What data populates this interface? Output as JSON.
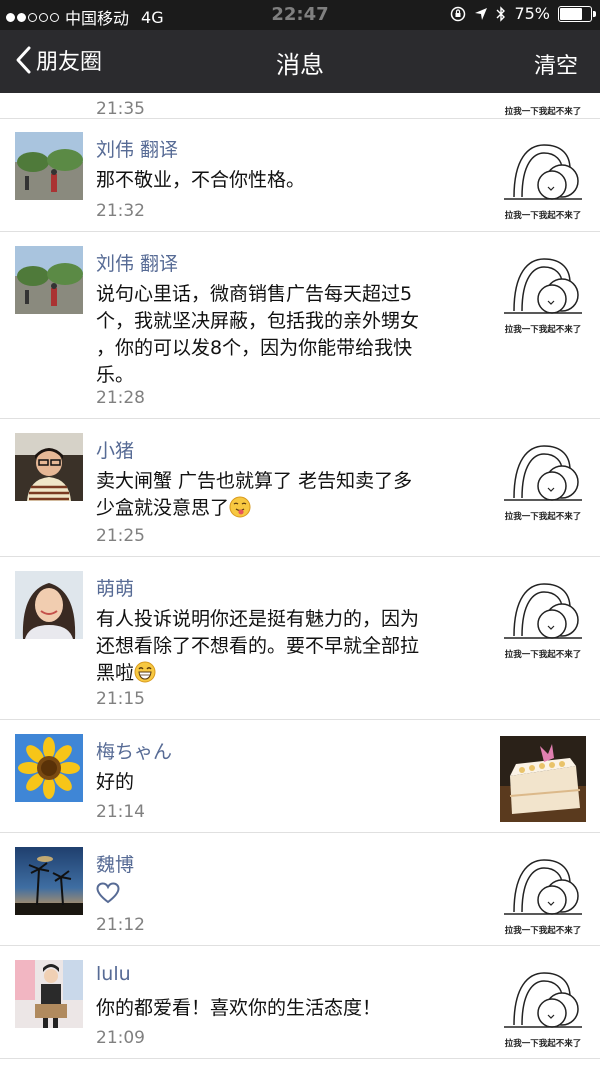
{
  "status": {
    "carrier": "中国移动",
    "network": "4G",
    "time": "22:47",
    "battery": "75%",
    "battery_level": 0.75
  },
  "nav": {
    "back_label": "朋友圈",
    "title": "消息",
    "clear_label": "清空"
  },
  "sticker_caption": "拉我一下我起不来了",
  "partial_row": {
    "time": "21:35"
  },
  "rows": [
    {
      "name": "刘伟 翻译",
      "message": "那不敬业，不合你性格。",
      "time": "21:32",
      "avatar": "park-photo",
      "thumb": "sticker"
    },
    {
      "name": "刘伟 翻译",
      "message_lines": [
        "说句心里话，微商销售广告每天超过5",
        "个，我就坚决屏蔽，包括我的亲外甥女",
        "，你的可以发8个，因为你能带给我快",
        "乐。"
      ],
      "time": "21:28",
      "avatar": "park-photo",
      "thumb": "sticker"
    },
    {
      "name": "小猪",
      "message_lines": [
        "卖大闸蟹 广告也就算了 老告知卖了多",
        "少盒就没意思了"
      ],
      "emoji": "tongue-face",
      "time": "21:25",
      "avatar": "man-photo",
      "thumb": "sticker"
    },
    {
      "name": "萌萌",
      "message_lines": [
        "有人投诉说明你还是挺有魅力的，因为",
        "还想看除了不想看的。要不早就全部拉",
        "黑啦"
      ],
      "emoji": "grin-face",
      "time": "21:15",
      "avatar": "woman-photo",
      "thumb": "sticker"
    },
    {
      "name": "梅ちゃん",
      "message": "好的",
      "time": "21:14",
      "avatar": "sunflower",
      "thumb": "cake-photo"
    },
    {
      "name": "魏博",
      "like": "heart",
      "time": "21:12",
      "avatar": "palm-sunset",
      "thumb": "sticker"
    },
    {
      "name": "lulu",
      "message": "你的都爱看！喜欢你的生活态度！",
      "time": "21:09",
      "avatar": "girl-photo",
      "thumb": "sticker"
    }
  ]
}
